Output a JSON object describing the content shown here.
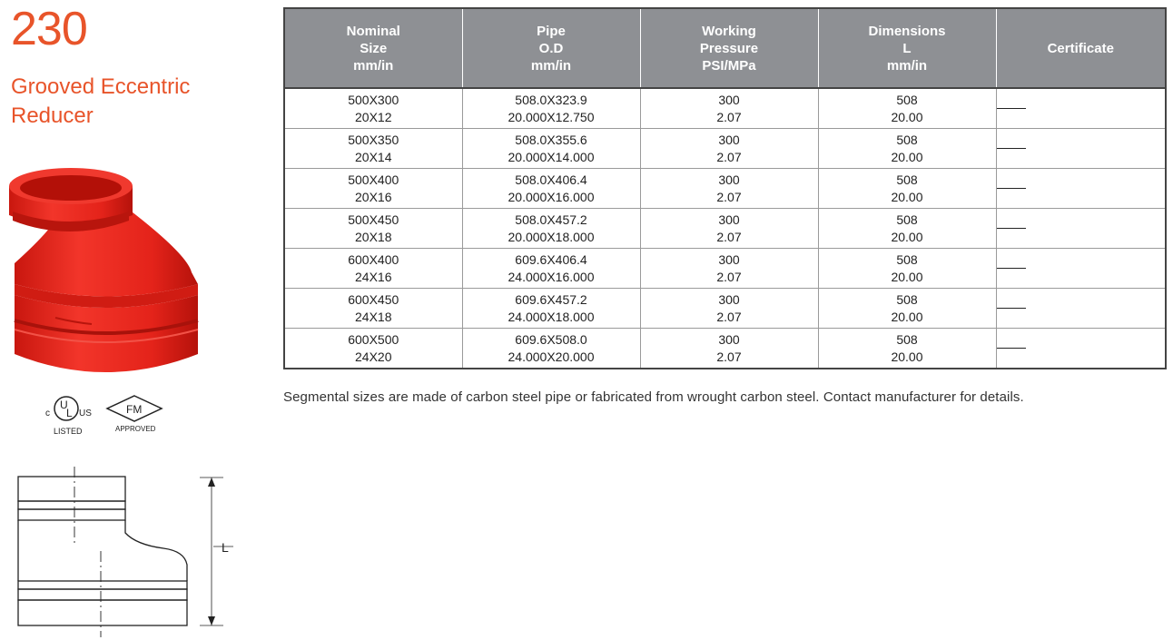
{
  "product": {
    "number": "230",
    "name": "Grooved Eccentric Reducer"
  },
  "colors": {
    "accent": "#e8542a",
    "header_bg": "#8e9094",
    "fitting_red": "#e8261f"
  },
  "logos": {
    "ul": {
      "icon": "ul-listed-icon",
      "c": "c",
      "us": "US",
      "u": "U",
      "l": "L",
      "caption": "LISTED"
    },
    "fm": {
      "icon": "fm-approved-icon",
      "text": "FM",
      "caption": "APPROVED"
    }
  },
  "drawing": {
    "icon": "eccentric-reducer-drawing-icon",
    "label": "L"
  },
  "table": {
    "headers": [
      [
        "Nominal",
        "Size",
        "mm/in"
      ],
      [
        "Pipe",
        "O.D",
        "mm/in"
      ],
      [
        "Working",
        "Pressure",
        "PSI/MPa"
      ],
      [
        "Dimensions",
        "L",
        "mm/in"
      ],
      [
        "Certificate"
      ]
    ],
    "rows": [
      [
        [
          "500X300",
          "20X12"
        ],
        [
          "508.0X323.9",
          "20.000X12.750"
        ],
        [
          "300",
          "2.07"
        ],
        [
          "508",
          "20.00"
        ],
        [
          "—"
        ]
      ],
      [
        [
          "500X350",
          "20X14"
        ],
        [
          "508.0X355.6",
          "20.000X14.000"
        ],
        [
          "300",
          "2.07"
        ],
        [
          "508",
          "20.00"
        ],
        [
          "—"
        ]
      ],
      [
        [
          "500X400",
          "20X16"
        ],
        [
          "508.0X406.4",
          "20.000X16.000"
        ],
        [
          "300",
          "2.07"
        ],
        [
          "508",
          "20.00"
        ],
        [
          "—"
        ]
      ],
      [
        [
          "500X450",
          "20X18"
        ],
        [
          "508.0X457.2",
          "20.000X18.000"
        ],
        [
          "300",
          "2.07"
        ],
        [
          "508",
          "20.00"
        ],
        [
          "—"
        ]
      ],
      [
        [
          "600X400",
          "24X16"
        ],
        [
          "609.6X406.4",
          "24.000X16.000"
        ],
        [
          "300",
          "2.07"
        ],
        [
          "508",
          "20.00"
        ],
        [
          "—"
        ]
      ],
      [
        [
          "600X450",
          "24X18"
        ],
        [
          "609.6X457.2",
          "24.000X18.000"
        ],
        [
          "300",
          "2.07"
        ],
        [
          "508",
          "20.00"
        ],
        [
          "—"
        ]
      ],
      [
        [
          "600X500",
          "24X20"
        ],
        [
          "609.6X508.0",
          "24.000X20.000"
        ],
        [
          "300",
          "2.07"
        ],
        [
          "508",
          "20.00"
        ],
        [
          "—"
        ]
      ]
    ]
  },
  "note": "Segmental sizes are made of carbon steel pipe or fabricated from wrought carbon steel. Contact manufacturer for details."
}
